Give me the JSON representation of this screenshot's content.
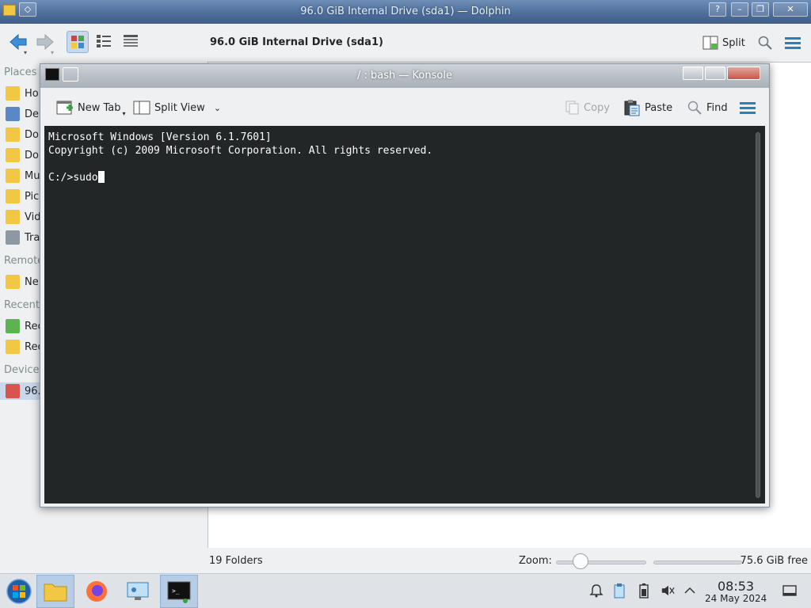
{
  "dolphin": {
    "title": "96.0 GiB Internal Drive (sda1) — Dolphin",
    "path": "96.0 GiB Internal Drive (sda1)",
    "split_label": "Split",
    "places": {
      "heading_places": "Places",
      "heading_remote": "Remote",
      "heading_recent": "Recent",
      "heading_devices": "Devices",
      "items": [
        {
          "label": "Ho",
          "icon": "home-folder-icon",
          "color": "#f2c744"
        },
        {
          "label": "De",
          "icon": "desktop-folder-icon",
          "color": "#5a87c5"
        },
        {
          "label": "Do",
          "icon": "documents-folder-icon",
          "color": "#f2c744"
        },
        {
          "label": "Do",
          "icon": "downloads-folder-icon",
          "color": "#f2c744"
        },
        {
          "label": "Mu",
          "icon": "music-folder-icon",
          "color": "#f2c744"
        },
        {
          "label": "Pic",
          "icon": "pictures-folder-icon",
          "color": "#f2c744"
        },
        {
          "label": "Vid",
          "icon": "videos-folder-icon",
          "color": "#f2c744"
        },
        {
          "label": "Tras",
          "icon": "trash-icon",
          "color": "#8d98a3"
        }
      ],
      "remote_items": [
        {
          "label": "Ne",
          "icon": "network-folder-icon",
          "color": "#f2c744"
        }
      ],
      "recent_items": [
        {
          "label": "Rec",
          "icon": "recent-files-icon",
          "color": "#5bb450"
        },
        {
          "label": "Rec",
          "icon": "recent-locations-icon",
          "color": "#f2c744"
        }
      ],
      "device_items": [
        {
          "label": "96.",
          "icon": "drive-icon",
          "color": "#d9534f"
        }
      ]
    },
    "status": {
      "count": "19 Folders",
      "zoom_label": "Zoom:",
      "free_space": "75.6 GiB free"
    }
  },
  "konsole": {
    "title": "/ : bash — Konsole",
    "toolbar": {
      "new_tab": "New Tab",
      "split_view": "Split View",
      "copy": "Copy",
      "paste": "Paste",
      "find": "Find"
    },
    "terminal": {
      "line1": "Microsoft Windows [Version 6.1.7601]",
      "line2": "Copyright (c) 2009 Microsoft Corporation. All rights reserved.",
      "prompt": "C:/>",
      "input": "sudo"
    }
  },
  "taskbar": {
    "apps": [
      "start-menu-icon",
      "file-manager-icon",
      "firefox-icon",
      "system-settings-icon",
      "konsole-icon"
    ],
    "clock_time": "08:53",
    "clock_date": "24 May 2024"
  },
  "colors": {
    "accent": "#3daee9",
    "terminal_bg": "#232627",
    "dolphin_titlebar": "#4f6f9c"
  }
}
